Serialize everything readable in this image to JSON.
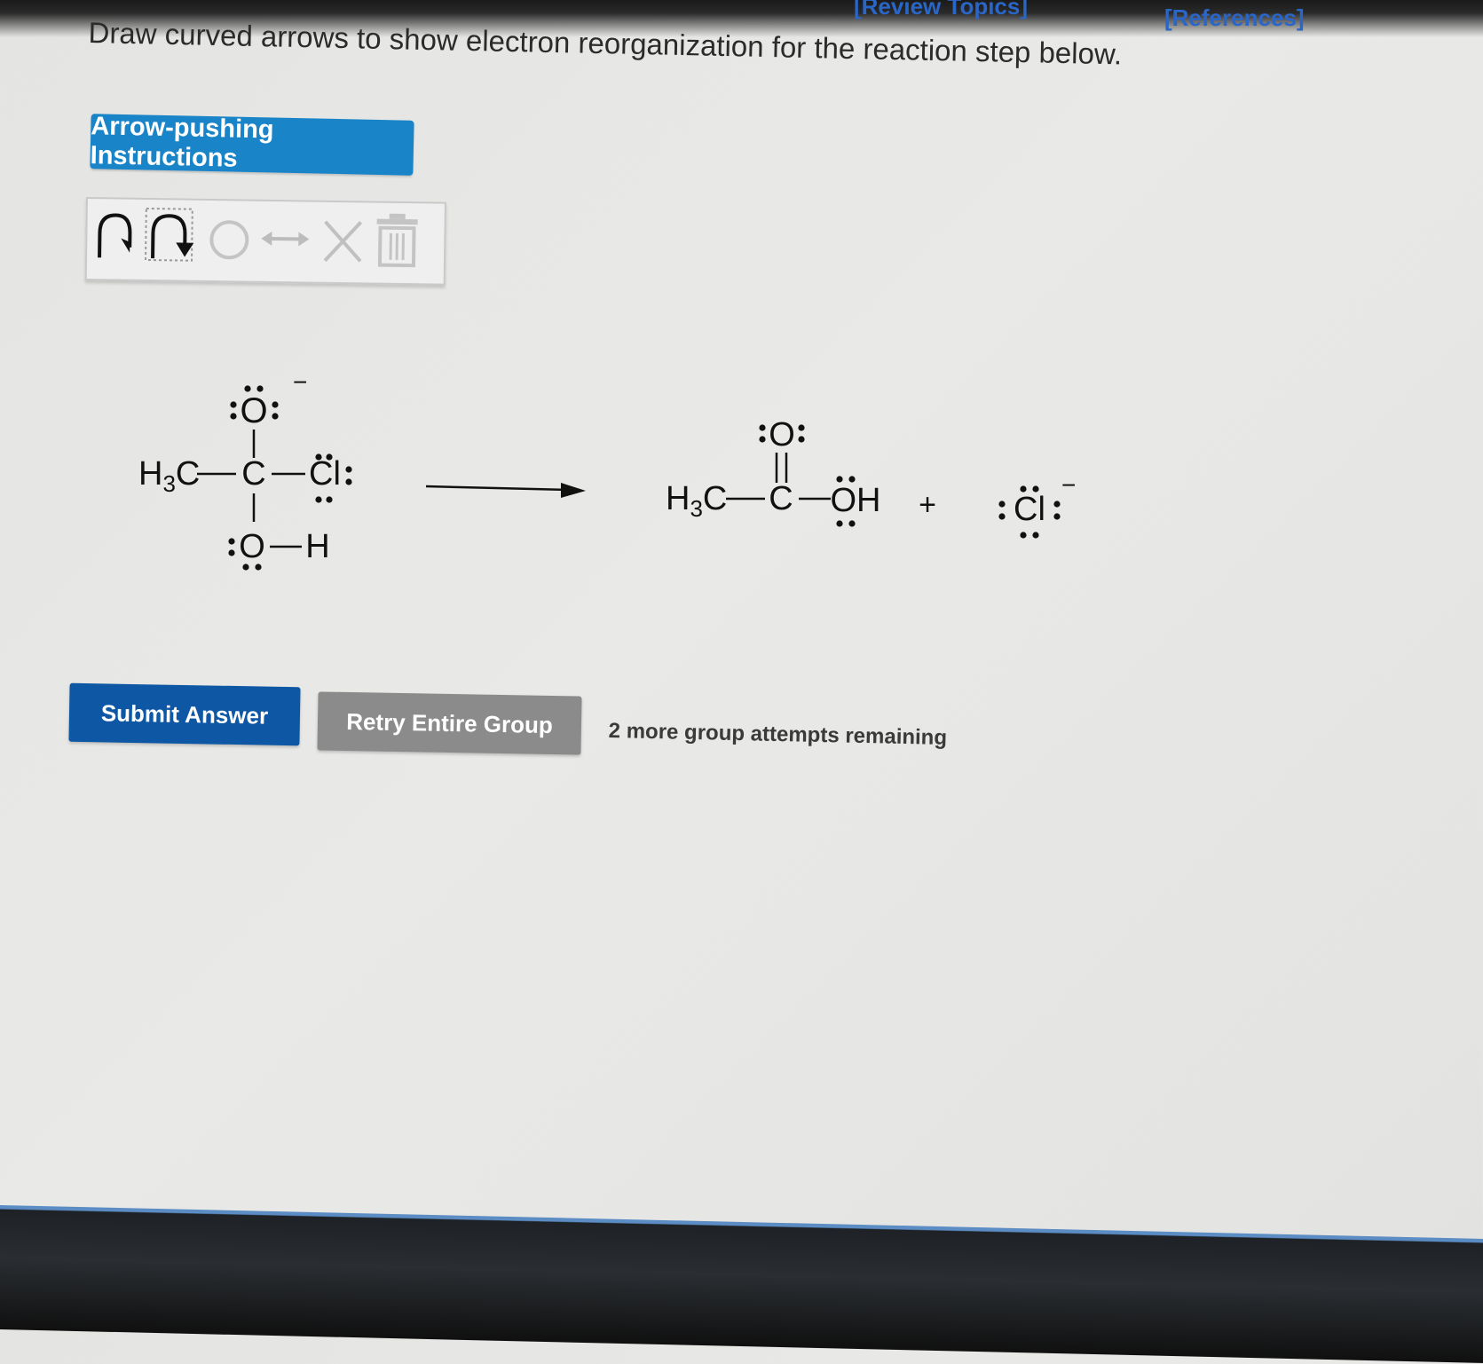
{
  "header": {
    "review_topics": "[Review Topics]",
    "references": "[References]"
  },
  "question": {
    "prompt": "Draw curved arrows to show electron reorganization for the reaction step below."
  },
  "instructions_button": "Arrow-pushing Instructions",
  "toolbar": {
    "tools": [
      "single-electron-arrow-icon",
      "electron-pair-arrow-icon",
      "lone-pair-tool-icon",
      "resonance-arrow-icon",
      "delete-x-icon",
      "trash-icon"
    ]
  },
  "reactant": {
    "o_top": "O",
    "charge": "−",
    "h3c": "H",
    "h3c_sub": "3",
    "h3c_c": "C",
    "c": "C",
    "cl": "Cl",
    "o_bottom": "O",
    "h": "H"
  },
  "product": {
    "o_top": "O",
    "h3c": "H",
    "h3c_sub": "3",
    "h3c_c": "C",
    "c": "C",
    "oh": "OH",
    "plus": "+",
    "cl": "Cl",
    "charge": "−"
  },
  "actions": {
    "submit": "Submit Answer",
    "retry": "Retry Entire Group",
    "attempts": "2 more group attempts remaining"
  },
  "colors": {
    "instructions_bg": "#1a84c8",
    "submit_bg": "#0d57a4",
    "retry_bg": "#8b8b8b",
    "link": "#2a66c8"
  }
}
